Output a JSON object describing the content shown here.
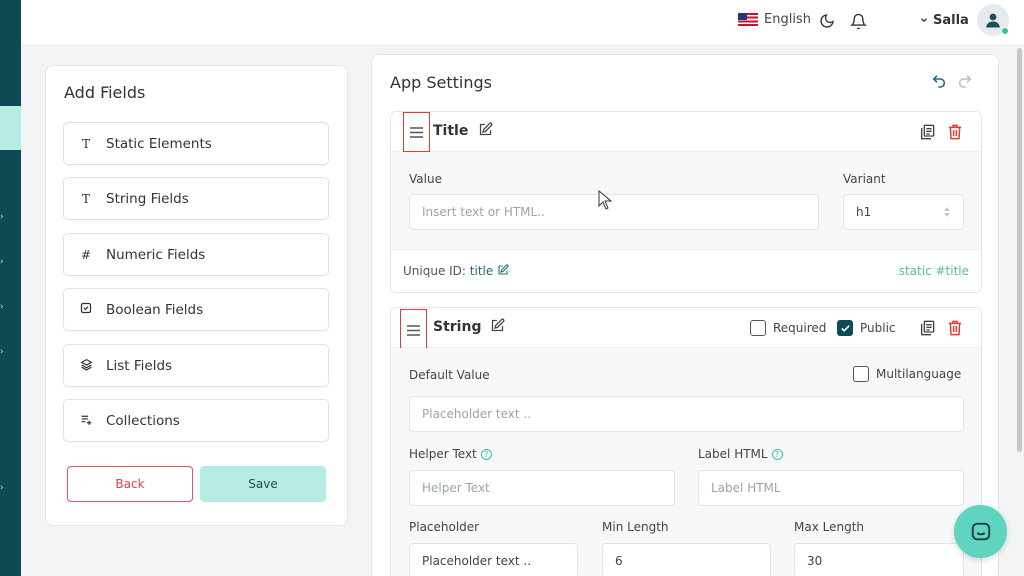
{
  "topbar": {
    "language": "English",
    "user_name": "Salla"
  },
  "add_fields": {
    "title": "Add Fields",
    "items": [
      {
        "icon": "T",
        "label": "Static Elements"
      },
      {
        "icon": "T",
        "label": "String Fields"
      },
      {
        "icon": "#",
        "label": "Numeric Fields"
      },
      {
        "icon": "checkbox-icon",
        "label": "Boolean Fields"
      },
      {
        "icon": "layers-icon",
        "label": "List Fields"
      },
      {
        "icon": "list-plus-icon",
        "label": "Collections"
      }
    ],
    "back_label": "Back",
    "save_label": "Save"
  },
  "settings": {
    "title": "App Settings",
    "title_card": {
      "title": "Title",
      "value_label": "Value",
      "value_placeholder": "Insert text or HTML..",
      "variant_label": "Variant",
      "variant_value": "h1",
      "unique_id_label": "Unique ID:",
      "unique_id_value": "title",
      "static_tag": "static #title"
    },
    "string_card": {
      "title": "String",
      "required_label": "Required",
      "required_checked": false,
      "public_label": "Public",
      "public_checked": true,
      "default_value_label": "Default Value",
      "default_value_placeholder": "Placeholder text ..",
      "multilanguage_label": "Multilanguage",
      "multilanguage_checked": false,
      "helper_text_label": "Helper Text",
      "helper_text_placeholder": "Helper Text",
      "label_html_label": "Label HTML",
      "label_html_placeholder": "Label HTML",
      "placeholder_label": "Placeholder",
      "placeholder_value": "Placeholder text ..",
      "min_length_label": "Min Length",
      "min_length_value": "6",
      "max_length_label": "Max Length",
      "max_length_value": "30"
    }
  },
  "colors": {
    "rail": "#0d4a53",
    "accent": "#b5ede3",
    "danger": "#e53935",
    "fab": "#5fd4be"
  }
}
